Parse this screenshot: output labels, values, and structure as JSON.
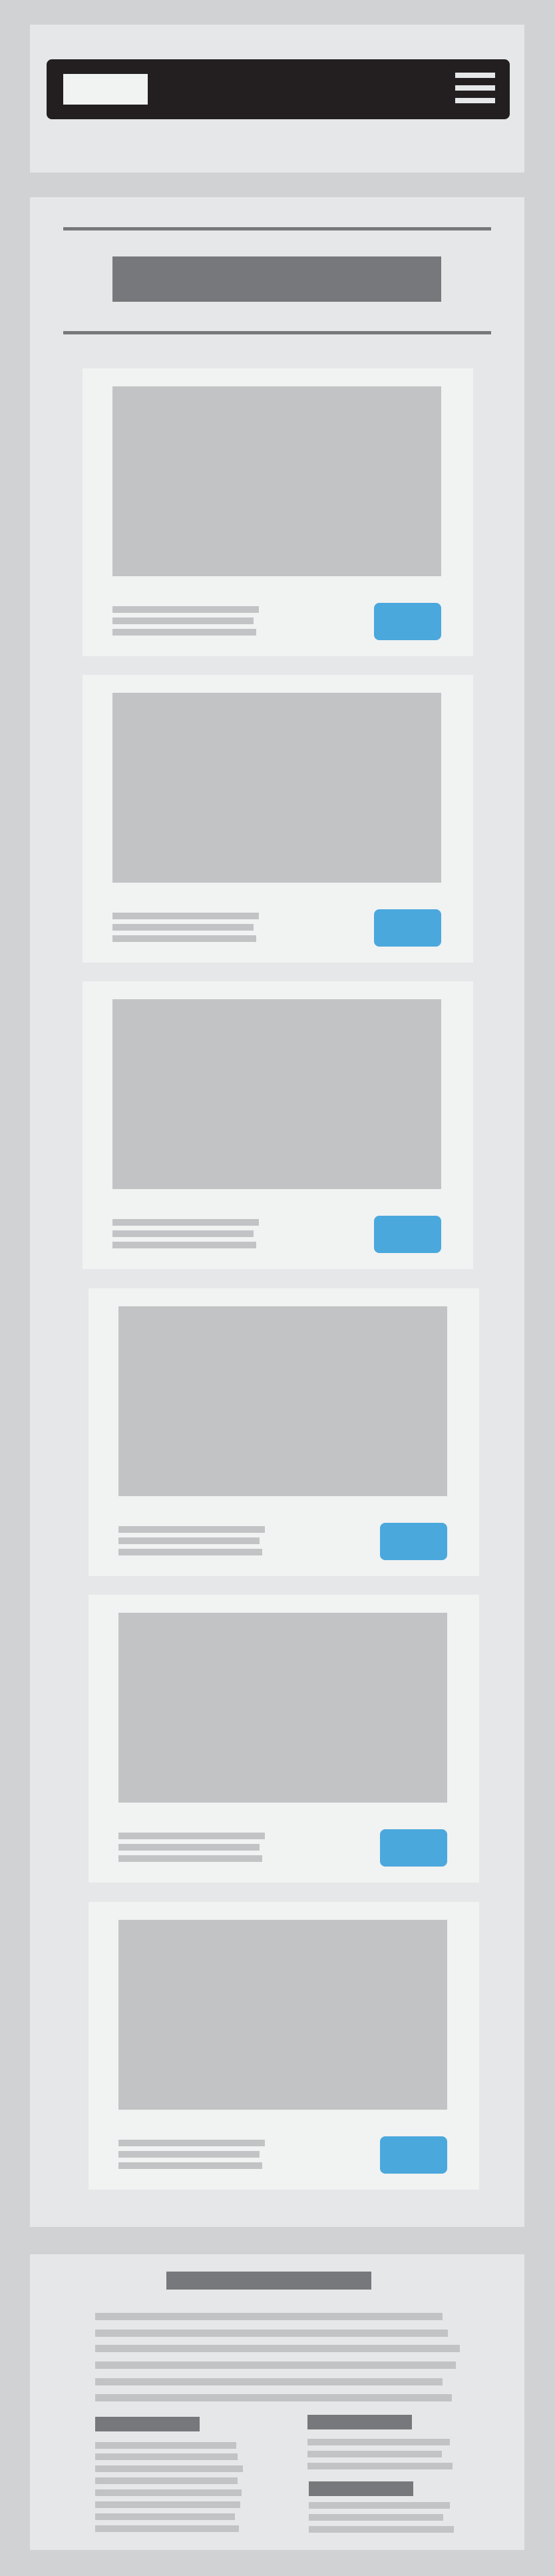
{
  "page": {
    "theme": {
      "background": "#d1d2d4",
      "panel": "#e6e7e8",
      "card": "#f1f2f2",
      "placeholder": "#c2c3c5",
      "heading_block": "#77787b",
      "topbar": "#231f20",
      "accent_button": "#4aa8dd"
    }
  },
  "header": {
    "logo_icon": "logo-placeholder",
    "menu_icon": "hamburger-menu-icon"
  },
  "main": {
    "cards": [
      {
        "button_label": ""
      },
      {
        "button_label": ""
      },
      {
        "button_label": ""
      },
      {
        "button_label": ""
      },
      {
        "button_label": ""
      },
      {
        "button_label": ""
      }
    ]
  }
}
